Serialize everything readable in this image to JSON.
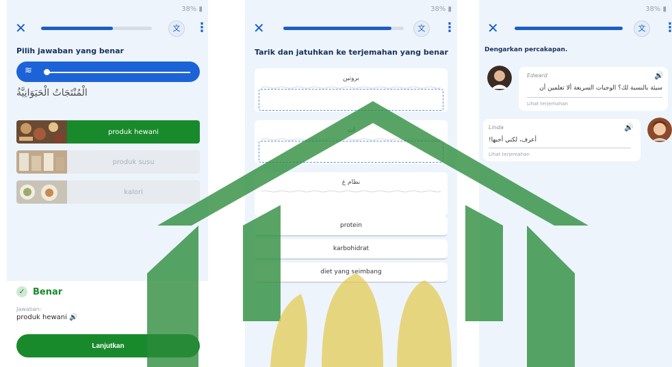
{
  "phone1": {
    "status": "38%",
    "progress": 0.65,
    "instruction": "Pilih jawaban yang benar",
    "arabic_word": "الْمُنْتَجَاتُ الْحَيَوَانِيَّةُ",
    "options": [
      {
        "label": "produk hewani",
        "selected": true
      },
      {
        "label": "produk susu",
        "selected": false
      },
      {
        "label": "kalori",
        "selected": false
      }
    ],
    "result": {
      "title": "Benar",
      "answer_label": "Jawaban:",
      "answer_value": "produk hewani",
      "continue_label": "Lanjutkan"
    }
  },
  "phone2": {
    "status": "38%",
    "progress": 0.9,
    "instruction": "Tarik dan jatuhkan ke terjemahan yang benar",
    "cards": [
      {
        "word": "بروتين"
      },
      {
        "word": "ات"
      },
      {
        "word": "نظام غ"
      }
    ],
    "chips": [
      "protein",
      "karbohidrat",
      "diet yang seimbang"
    ]
  },
  "phone3": {
    "status": "38%",
    "progress": 1.0,
    "instruction": "Dengarkan percakapan.",
    "messages": [
      {
        "name": "Edward",
        "text": "سيئة بالنسبة لك؟  الوجبات السريعة  ألا تعلمين أن",
        "translate": "Lihat terjemahan"
      },
      {
        "name": "Linda",
        "text": "أعرف، لكني أحبها!",
        "translate": "Lihat terjemahan"
      }
    ]
  },
  "colors": {
    "brand_blue": "#1d63d8",
    "correct_green": "#188a2b",
    "background": "#eef4fc",
    "watermark": "#2a8a3a"
  },
  "icons": {
    "close": "close-icon",
    "translate": "translate-icon",
    "more": "more-vert-icon",
    "speaker": "speaker-icon",
    "check": "check-icon"
  }
}
